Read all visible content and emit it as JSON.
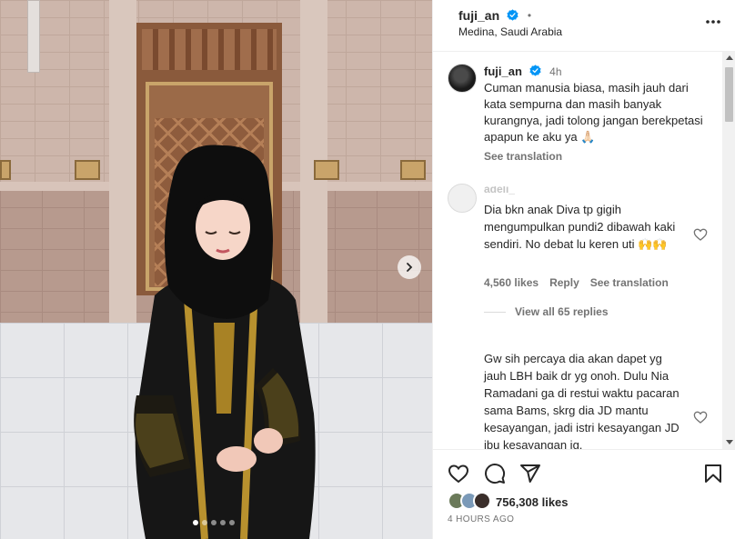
{
  "post": {
    "carousel": {
      "slide_count": 5,
      "active_index": 0
    }
  },
  "header": {
    "username": "fuji_an",
    "location": "Medina, Saudi Arabia",
    "dot": "•"
  },
  "caption": {
    "username": "fuji_an",
    "time": "4h",
    "text": "Cuman manusia biasa, masih jauh dari kata sempurna dan masih banyak kurangnya, jadi tolong jangan berekpetasi apapun ke aku ya 🙏🏻",
    "see_translation": "See translation"
  },
  "comments": [
    {
      "username": "adeli_",
      "text": "Dia bkn anak Diva tp gigih mengumpulkan pundi2 dibawah kaki sendiri. No debat lu keren uti 🙌🙌",
      "likes": "4,560 likes",
      "reply": "Reply",
      "see_translation": "See translation",
      "view_replies": "View all 65 replies"
    },
    {
      "username": "",
      "text": "Gw sih percaya dia akan dapet yg jauh LBH baik dr yg onoh. Dulu Nia Ramadani ga di restui waktu pacaran sama Bams, skrg dia JD mantu kesayangan, jadi istri kesayangan JD ibu kesayangan jg."
    }
  ],
  "footer": {
    "likes": "756,308 likes",
    "time_ago": "4 HOURS AGO"
  },
  "colors": {
    "verified": "#0095f6",
    "text_primary": "#262626",
    "text_secondary": "#737373"
  }
}
